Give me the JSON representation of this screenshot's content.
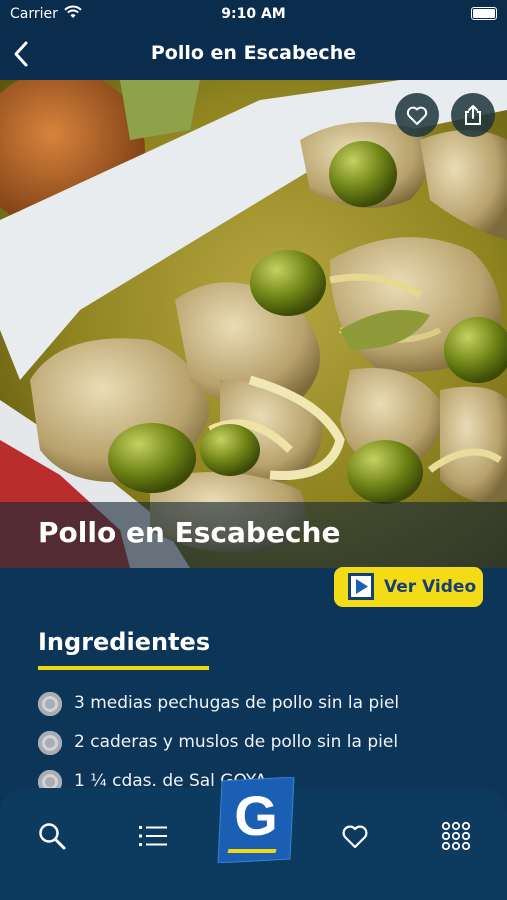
{
  "status_bar": {
    "carrier": "Carrier",
    "time": "9:10 AM"
  },
  "nav": {
    "title": "Pollo en Escabeche",
    "back_icon": "chevron-left-icon"
  },
  "hero": {
    "recipe_name": "Pollo en Escabeche",
    "favorite_icon": "heart-outline-icon",
    "share_icon": "share-icon"
  },
  "video_button": {
    "label": "Ver Video",
    "icon": "play-icon"
  },
  "ingredients": {
    "title": "Ingredientes",
    "items": [
      "3 medias pechugas de pollo sin la piel",
      "2 caderas y muslos de pollo sin la piel",
      "1 ¼ cdas. de Sal GOYA"
    ]
  },
  "tab_bar": {
    "items": [
      {
        "name": "search",
        "icon": "search-icon"
      },
      {
        "name": "list",
        "icon": "list-icon"
      },
      {
        "name": "home",
        "icon": "goya-logo",
        "letter": "G"
      },
      {
        "name": "favorites",
        "icon": "heart-outline-icon"
      },
      {
        "name": "menu",
        "icon": "grid-icon"
      }
    ]
  },
  "colors": {
    "background": "#0d3558",
    "nav_background": "#0a2c4d",
    "accent_yellow": "#f3dc16",
    "logo_blue": "#1b5fb5"
  }
}
